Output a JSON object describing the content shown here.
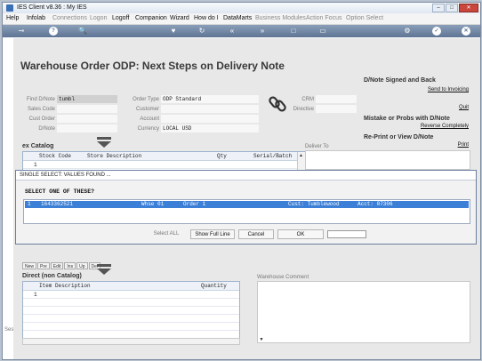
{
  "window": {
    "title": "IES Client v8.36 : My IES"
  },
  "menu": {
    "items": [
      {
        "label": "Help",
        "dim": false
      },
      {
        "label": "Infolab",
        "dim": false
      },
      {
        "label": "Connections",
        "dim": true
      },
      {
        "label": "Logon",
        "dim": true
      },
      {
        "label": "Logoff",
        "dim": false
      },
      {
        "label": "Companion",
        "dim": false
      },
      {
        "label": "Wizard",
        "dim": false
      },
      {
        "label": "How do I",
        "dim": false
      },
      {
        "label": "DataMarts",
        "dim": false
      },
      {
        "label": "Business Modules",
        "dim": true
      },
      {
        "label": "Action Focus",
        "dim": true
      },
      {
        "label": "Option Select",
        "dim": true
      }
    ]
  },
  "toolbar": {
    "key_glyph": "⊸",
    "help_glyph": "?",
    "search_glyph": "🔍",
    "heart_glyph": "♥",
    "refresh_glyph": "↻",
    "back_glyph": "«",
    "forward_glyph": "»",
    "square_glyph": "□",
    "doc_glyph": "▭",
    "gear_glyph": "⚙",
    "ok_glyph": "✓",
    "close_glyph": "✕"
  },
  "page": {
    "title": "Warehouse Order ODP: Next Steps on Delivery Note",
    "fields": {
      "find_dnote": {
        "label": "Find D/Note",
        "value": "tumbl"
      },
      "sales_code": {
        "label": "Sales Code",
        "value": ""
      },
      "cust_order": {
        "label": "Cust Order",
        "value": ""
      },
      "dnote": {
        "label": "D/Note",
        "value": ""
      },
      "order_type": {
        "label": "Order Type",
        "value": "ODP Standard"
      },
      "customer": {
        "label": "Customer",
        "value": ""
      },
      "account": {
        "label": "Account",
        "value": ""
      },
      "currency": {
        "label": "Currency",
        "value": "LOCAL USD"
      },
      "crm": {
        "label": "CRM",
        "value": ""
      },
      "directive": {
        "label": "Directive",
        "value": ""
      }
    },
    "right_panel": {
      "signed_head": "D/Note Signed and Back",
      "send_link": "Send to Invoicing",
      "quit_link": "Quit",
      "mistake_head": "Mistake or Probs with D/Note",
      "reverse_link": "Reverse Completely",
      "reprint_head": "Re-Print or View D/Note",
      "print_link": "Print"
    },
    "ex_catalog": {
      "heading": "ex Catalog",
      "columns": [
        "Stock Code",
        "Store Description",
        "Qty",
        "Serial/Batch"
      ],
      "row_numbers": [
        "1"
      ],
      "deliver_to_label": "Deliver To"
    },
    "tabs": [
      "New",
      "Pre",
      "Edit",
      "Ins",
      "Up",
      "Del"
    ],
    "direct": {
      "heading": "Direct (non Catalog)",
      "columns": [
        "Item Description",
        "Quantity"
      ],
      "row_numbers": [
        "1"
      ],
      "warehouse_comment_label": "Warehouse Comment",
      "side_label": "Ses"
    }
  },
  "modal": {
    "title": "SINGLE SELECT: VALUES FOUND ...",
    "prompt": "SELECT ONE OF THESE?",
    "rows": [
      {
        "num": "1",
        "code": "1643362521",
        "whse": "Whse 01",
        "order": "Order 1",
        "cust": "Cust: Tumblewood",
        "acct": "Acct: 07306"
      }
    ],
    "buttons": {
      "select_all": "Select ALL",
      "show_full_line": "Show Full Line",
      "cancel": "Cancel",
      "ok": "OK"
    },
    "input_value": ""
  },
  "colors": {
    "toolbar": "#5e7494",
    "selection": "#3b7fd6",
    "grid_border": "#9fb3cc"
  }
}
